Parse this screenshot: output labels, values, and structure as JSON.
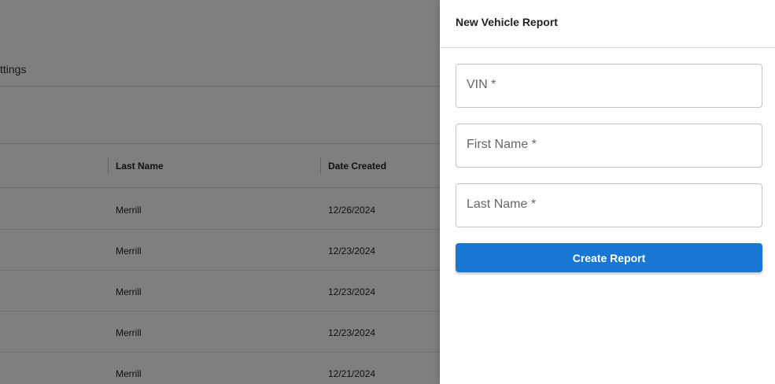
{
  "background": {
    "tab_label": "ttings",
    "table": {
      "columns": [
        "Last Name",
        "Date Created"
      ],
      "rows": [
        {
          "last_name": "Merrill",
          "date_created": "12/26/2024"
        },
        {
          "last_name": "Merrill",
          "date_created": "12/23/2024"
        },
        {
          "last_name": "Merrill",
          "date_created": "12/23/2024"
        },
        {
          "last_name": "Merrill",
          "date_created": "12/23/2024"
        },
        {
          "last_name": "Merrill",
          "date_created": "12/21/2024"
        }
      ]
    }
  },
  "drawer": {
    "title": "New Vehicle Report",
    "fields": [
      {
        "label": "VIN *"
      },
      {
        "label": "First Name *"
      },
      {
        "label": "Last Name *"
      }
    ],
    "submit_label": "Create Report",
    "accent_color": "#1976d2"
  }
}
